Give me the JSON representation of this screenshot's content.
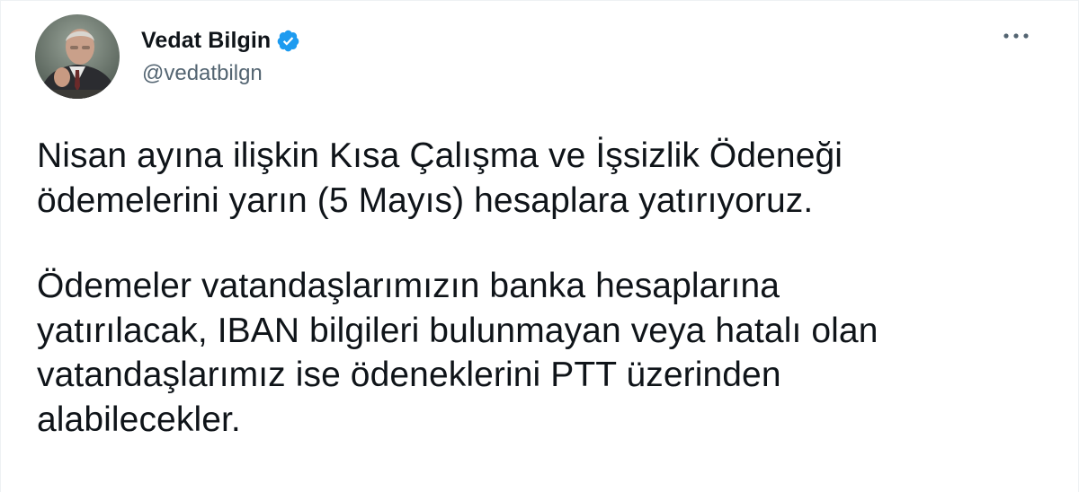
{
  "tweet": {
    "author": {
      "display_name": "Vedat Bilgin",
      "handle": "@vedatbilgn",
      "verified": true
    },
    "paragraphs": [
      "Nisan ayına ilişkin Kısa Çalışma ve İşsizlik Ödeneği\nödemelerini yarın (5 Mayıs) hesaplara yatırıyoruz.",
      "Ödemeler vatandaşlarımızın banka hesaplarına\nyatırılacak, IBAN bilgileri bulunmayan veya hatalı olan\nvatandaşlarımız ise ödeneklerini PTT üzerinden\nalabilecekler."
    ]
  },
  "icons": {
    "verified": "verified-badge-icon",
    "more": "more-options-icon"
  },
  "colors": {
    "text_primary": "#0f1419",
    "text_secondary": "#536471",
    "verified_blue": "#1d9bf0"
  }
}
